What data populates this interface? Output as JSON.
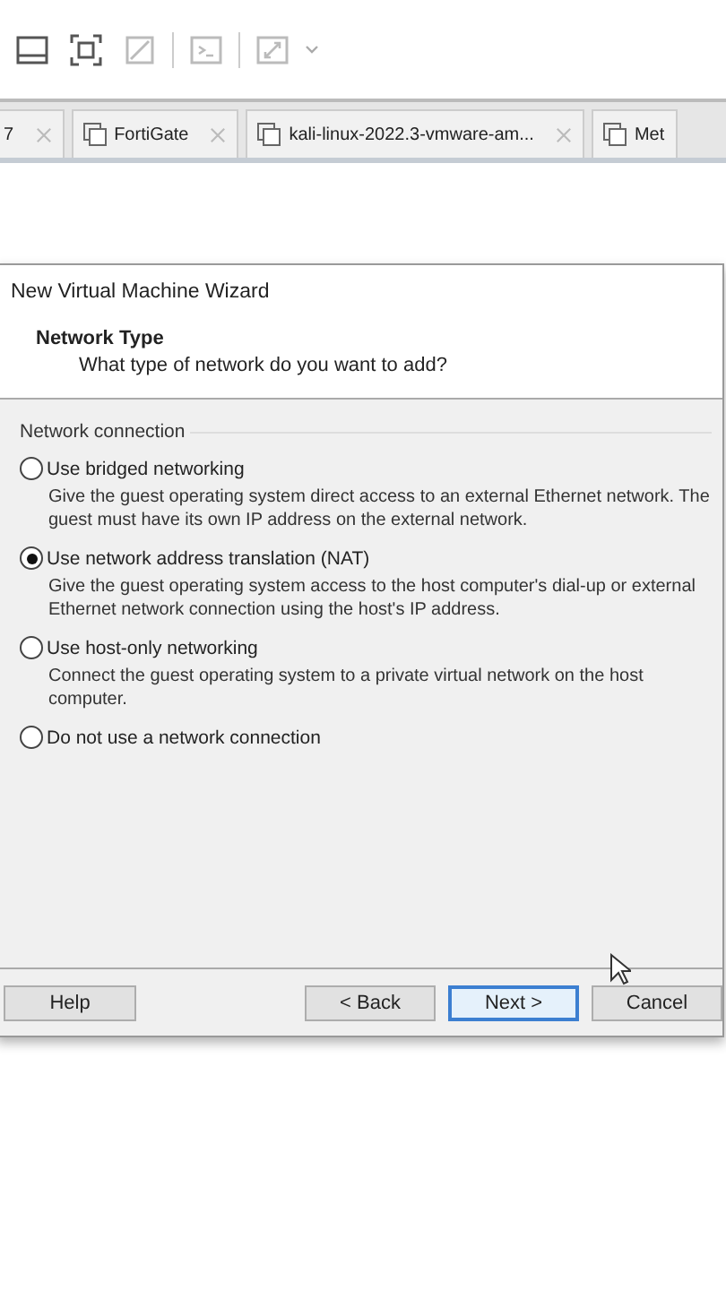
{
  "tabs": [
    {
      "label": "7",
      "selected": false
    },
    {
      "label": "FortiGate",
      "selected": false
    },
    {
      "label": "kali-linux-2022.3-vmware-am...",
      "selected": false
    },
    {
      "label": "Met",
      "selected": false
    }
  ],
  "dialog": {
    "title": "New Virtual Machine Wizard",
    "heading": "Network Type",
    "subheading": "What type of network do you want to add?",
    "group_label": "Network connection",
    "options": [
      {
        "label": "Use bridged networking",
        "description": "Give the guest operating system direct access to an external Ethernet network. The guest must have its own IP address on the external network.",
        "selected": false
      },
      {
        "label": "Use network address translation (NAT)",
        "description": "Give the guest operating system access to the host computer's dial-up or external Ethernet network connection using the host's IP address.",
        "selected": true
      },
      {
        "label": "Use host-only networking",
        "description": "Connect the guest operating system to a private virtual network on the host computer.",
        "selected": false
      },
      {
        "label": "Do not use a network connection",
        "selected": false
      }
    ],
    "buttons": [
      {
        "label": "Help",
        "kind": "help"
      },
      {
        "label": "< Back",
        "kind": "normal"
      },
      {
        "label": "Next >",
        "kind": "default"
      },
      {
        "label": "Cancel",
        "kind": "normal"
      }
    ]
  }
}
